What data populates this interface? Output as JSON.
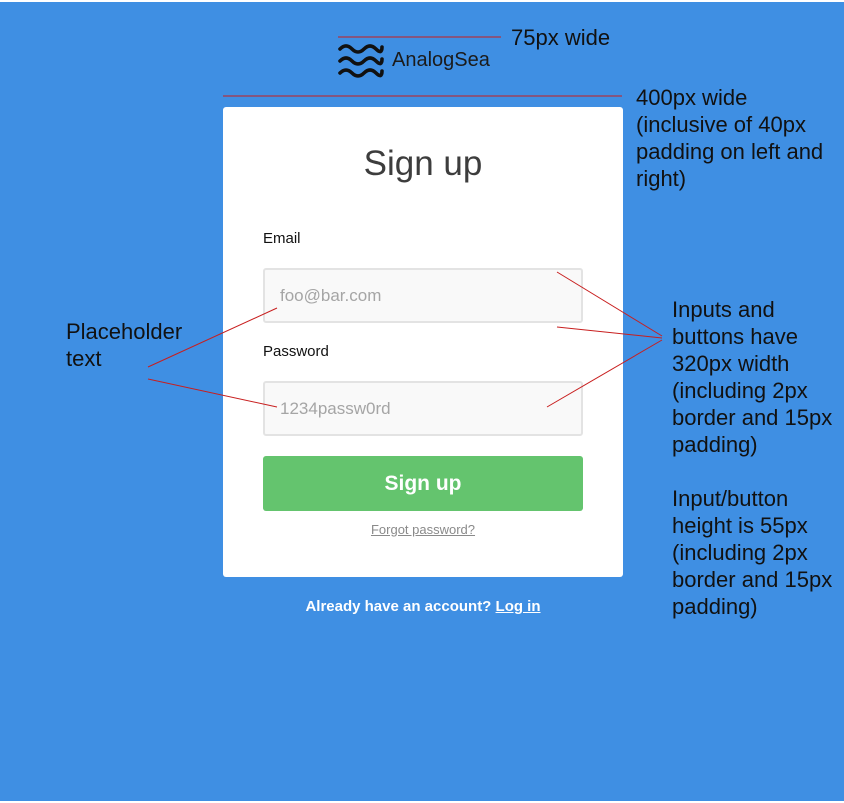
{
  "brand": {
    "name": "AnalogSea",
    "logo_icon": "waves-icon"
  },
  "form": {
    "title": "Sign up",
    "email_label": "Email",
    "email_placeholder": "foo@bar.com",
    "password_label": "Password",
    "password_placeholder": "1234passw0rd",
    "submit_label": "Sign up",
    "forgot_link": "Forgot password?"
  },
  "footer": {
    "prompt": "Already have an account?",
    "login_link": "Log in"
  },
  "annotations": {
    "logo_width": "75px wide",
    "card_width": "400px wide (inclusive of 40px padding on left and right)",
    "placeholder_note": "Placeholder text",
    "inputs_note": "Inputs and buttons have 320px width (including 2px border and 15px padding)",
    "height_note": "Input/button height is 55px (including 2px border and 15px padding)"
  },
  "colors": {
    "background": "#3f8fe3",
    "card": "#ffffff",
    "button": "#64c46e",
    "annotation_line": "#c81e1e"
  }
}
